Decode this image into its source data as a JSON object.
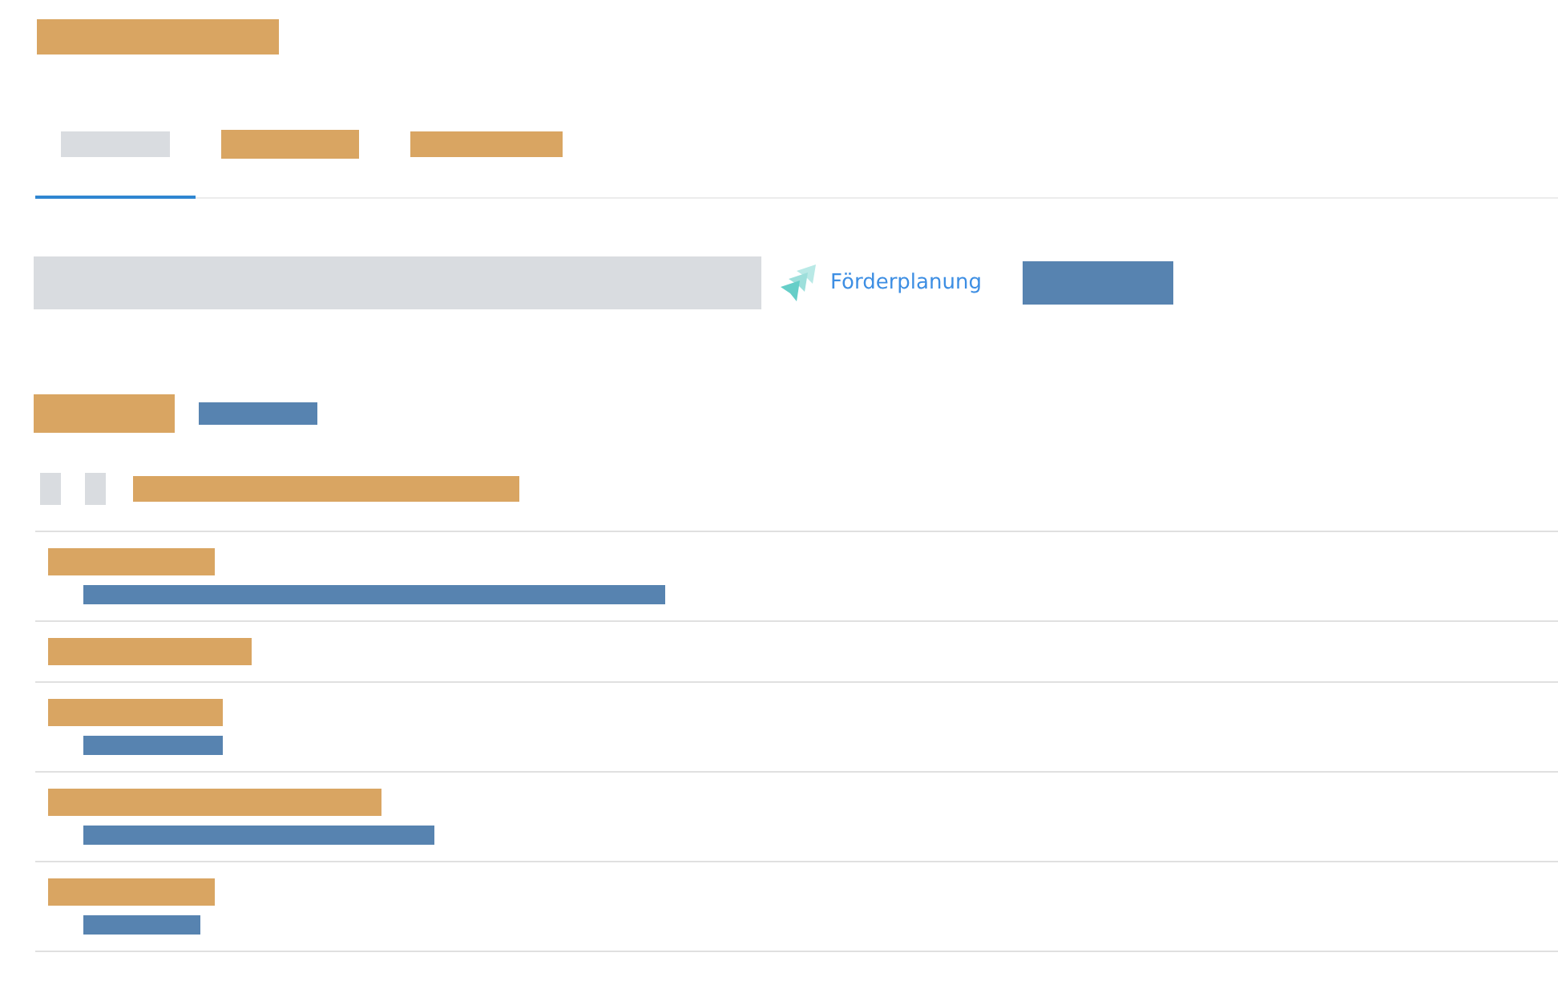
{
  "page_title": {
    "color": "#d9a562"
  },
  "tabs": [
    {
      "selected": true,
      "color": "#d9dce0"
    },
    {
      "selected": false,
      "color": "#d9a562"
    },
    {
      "selected": false,
      "color": "#d9a562"
    }
  ],
  "toolbar": {
    "search_field": {
      "color": "#d9dce0"
    },
    "link": {
      "label": "Förderplanung"
    },
    "button": {
      "color": "#5783b0"
    }
  },
  "section": {
    "heading": {
      "color": "#d9a562"
    },
    "action": {
      "color": "#5783b0"
    }
  },
  "list_header": {
    "marks": [
      {
        "color": "#d9dce0"
      },
      {
        "color": "#d9dce0"
      }
    ],
    "label": {
      "color": "#d9a562"
    }
  },
  "rows": [
    {
      "title": {
        "color": "#d9a562"
      },
      "subtitle": {
        "color": "#5783b0"
      }
    },
    {
      "title": {
        "color": "#d9a562"
      }
    },
    {
      "title": {
        "color": "#d9a562"
      },
      "subtitle": {
        "color": "#5783b0"
      }
    },
    {
      "title": {
        "color": "#d9a562"
      },
      "subtitle": {
        "color": "#5783b0"
      }
    },
    {
      "title": {
        "color": "#d9a562"
      },
      "subtitle": {
        "color": "#5783b0"
      }
    }
  ]
}
